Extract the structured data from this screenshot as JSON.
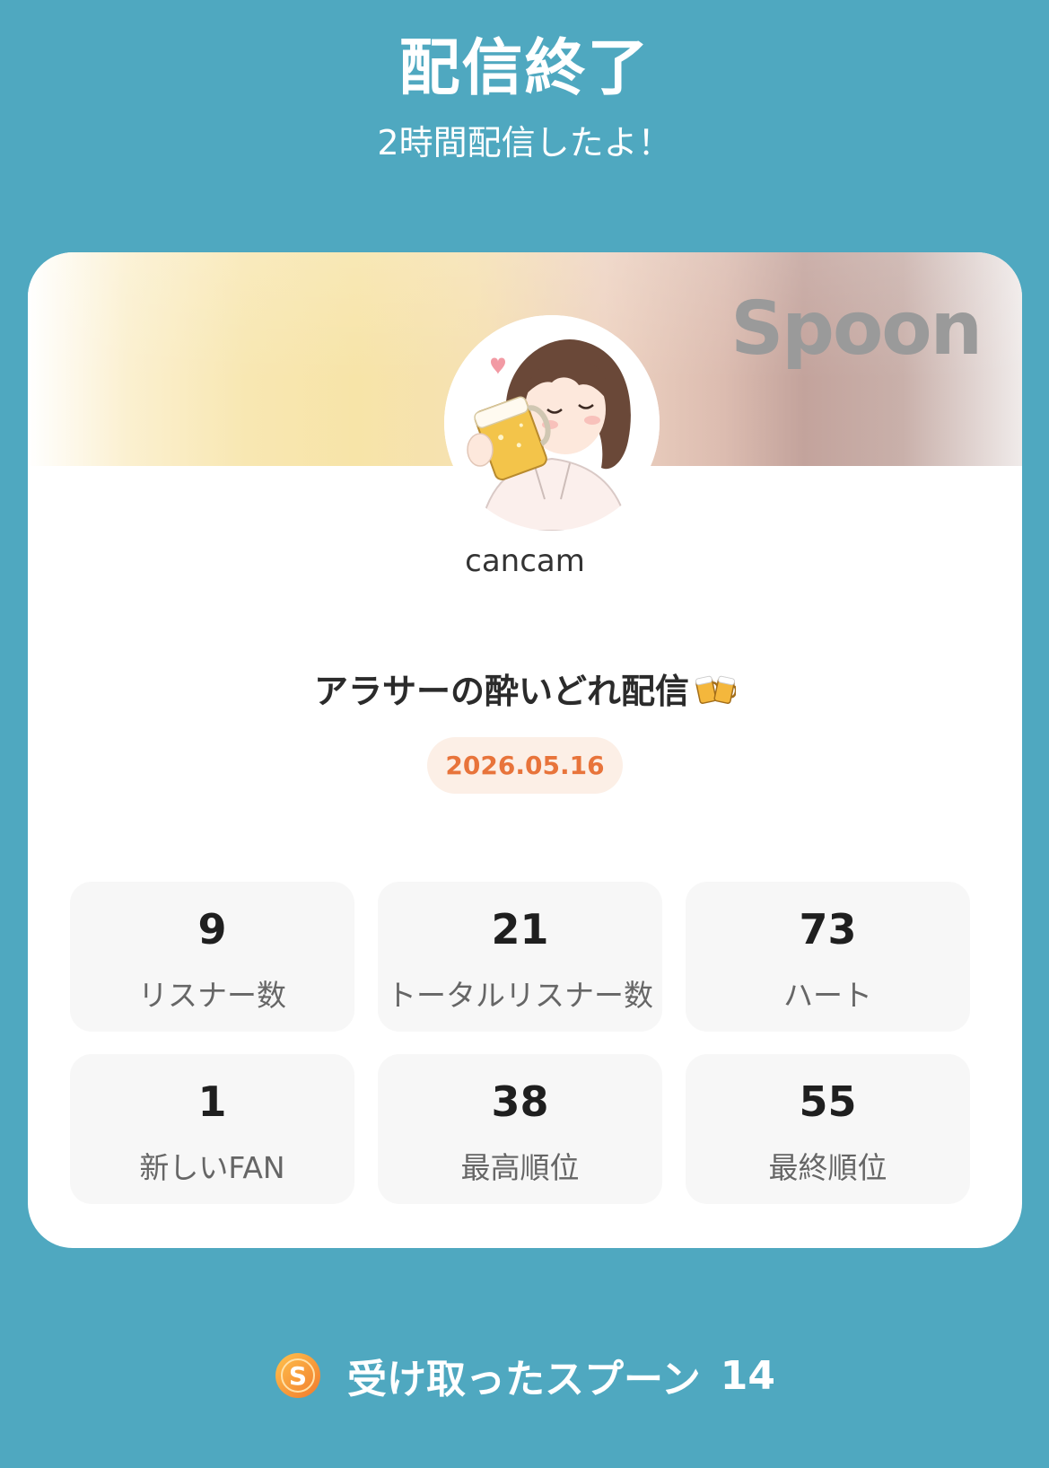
{
  "header": {
    "title": "配信終了",
    "subtitle": "2時間配信したよ！"
  },
  "card": {
    "brand": "Spoon",
    "username": "cancam",
    "live_title": "アラサーの酔いどれ配信",
    "title_emoji_icon": "beer-mugs-icon",
    "date": "2026.05.16",
    "date_color": "#e8743b"
  },
  "stats": [
    {
      "value": "9",
      "label": "リスナー数"
    },
    {
      "value": "21",
      "label": "トータルリスナー数"
    },
    {
      "value": "73",
      "label": "ハート"
    },
    {
      "value": "1",
      "label": "新しいFAN"
    },
    {
      "value": "38",
      "label": "最高順位"
    },
    {
      "value": "55",
      "label": "最終順位"
    }
  ],
  "spoons": {
    "icon": "spoon-coin-icon",
    "label": "受け取ったスプーン",
    "count": "14"
  },
  "colors": {
    "background": "#4fa8c0",
    "card": "#ffffff",
    "stat_tile": "#f7f7f7",
    "accent": "#e8743b"
  }
}
